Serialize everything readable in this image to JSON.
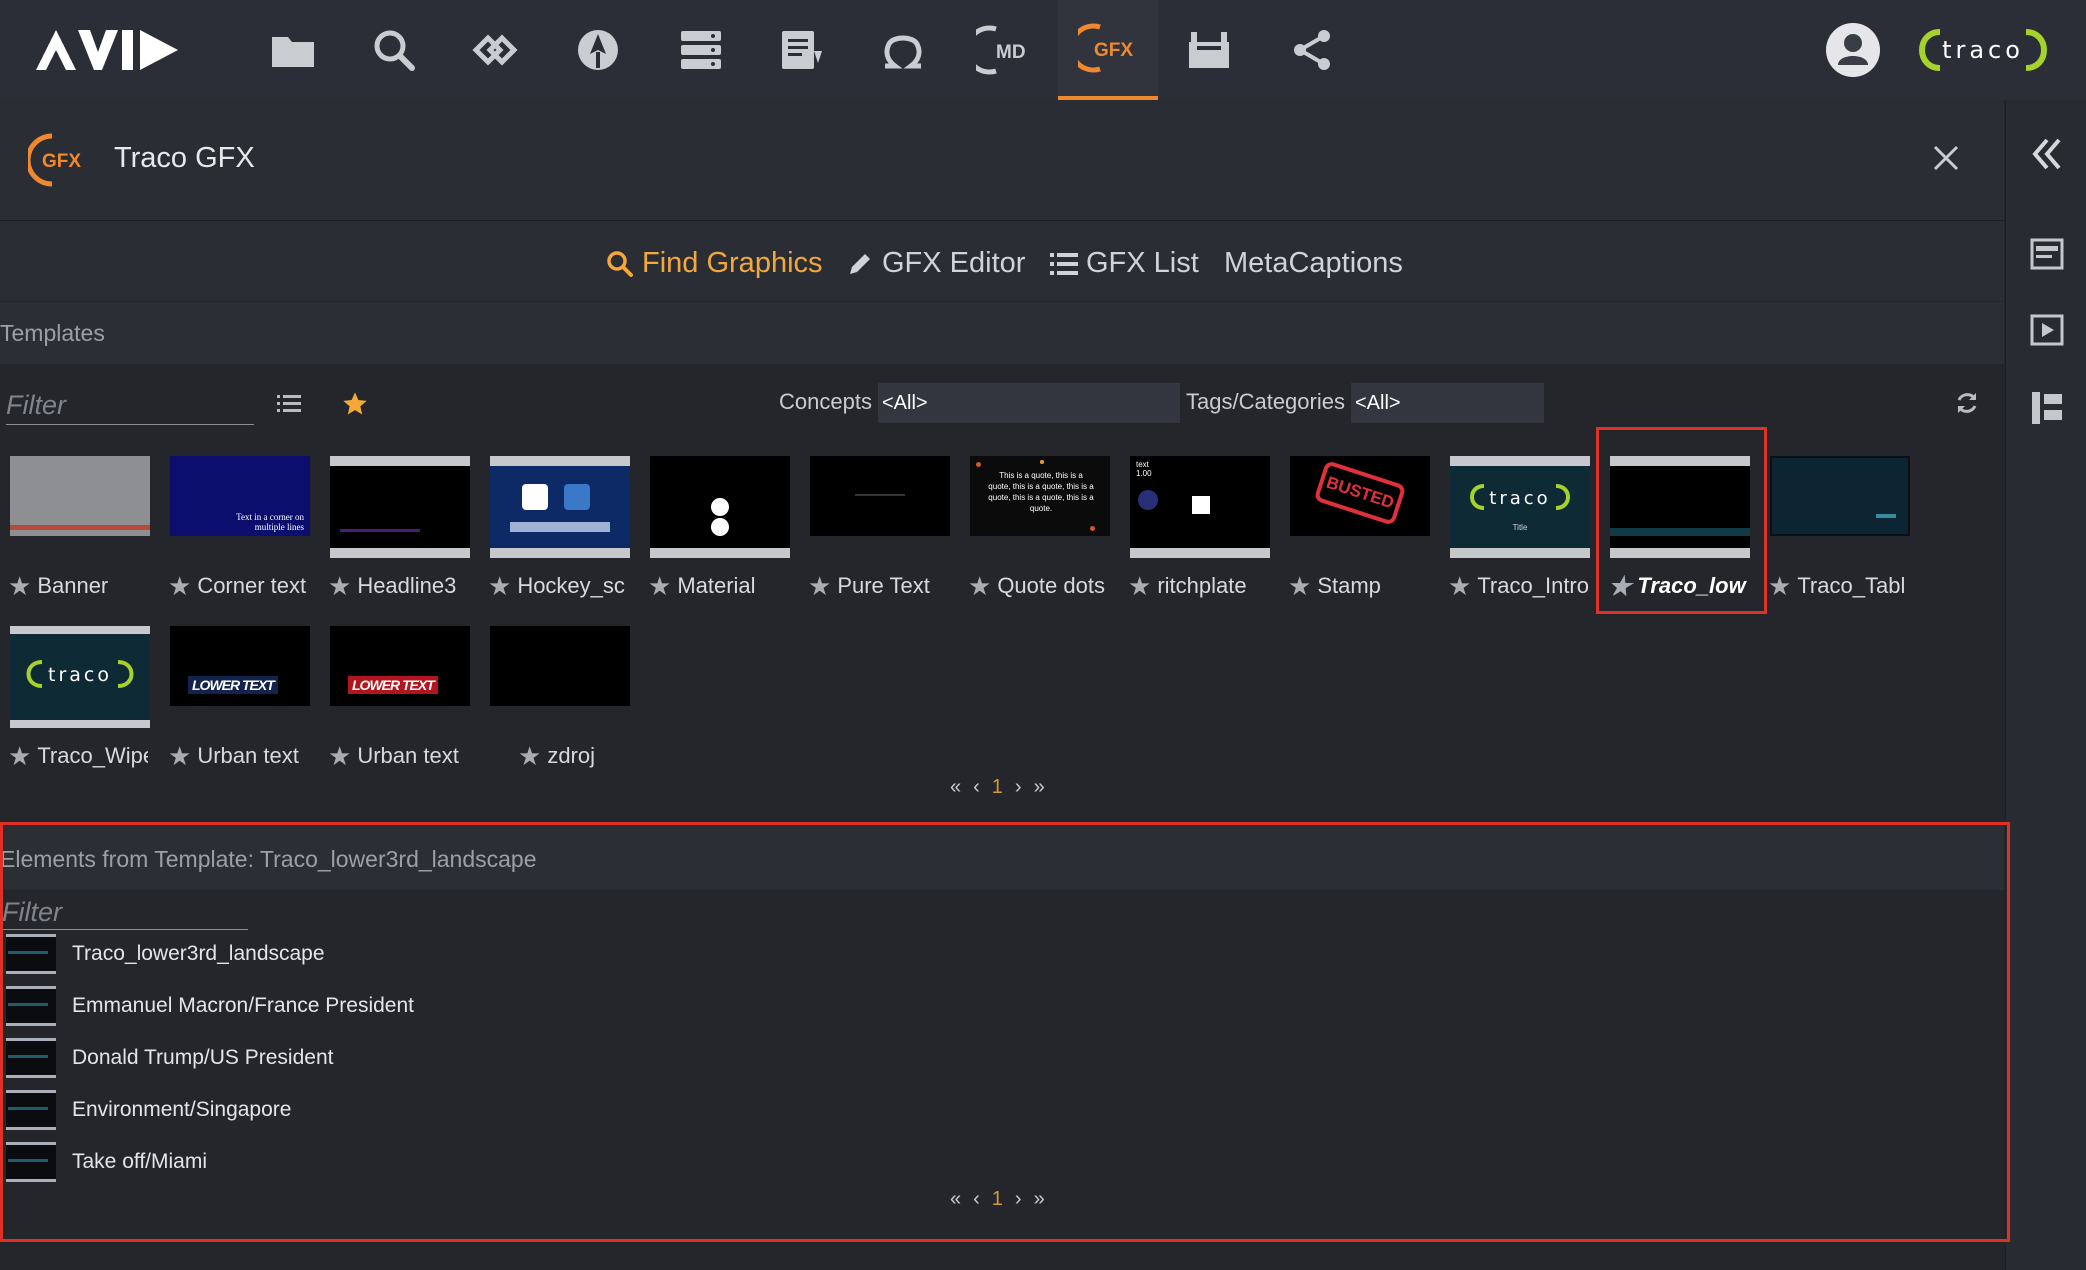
{
  "topbar": {
    "logo": "AVID",
    "nav": [
      {
        "name": "folder-icon"
      },
      {
        "name": "search-icon"
      },
      {
        "name": "link-icon"
      },
      {
        "name": "rocket-icon"
      },
      {
        "name": "server-icon"
      },
      {
        "name": "document-icon"
      },
      {
        "name": "omega-icon"
      },
      {
        "name": "md-icon",
        "label": "MD"
      },
      {
        "name": "gfx-icon",
        "label": "GFX",
        "active": true
      },
      {
        "name": "clapper-icon"
      },
      {
        "name": "share-icon"
      }
    ],
    "brand": "traco",
    "accent": "#f0882e"
  },
  "panel": {
    "icon_label": "GFX",
    "title": "Traco GFX",
    "tabs": {
      "find": "Find Graphics",
      "editor": "GFX Editor",
      "list": "GFX List",
      "meta": "MetaCaptions"
    },
    "templates": {
      "section_title": "Templates",
      "filter_placeholder": "Filter",
      "concepts_label": "Concepts",
      "concepts_value": "<All>",
      "tags_label": "Tags/Categories",
      "tags_value": "<All>",
      "items": [
        {
          "label": "Banner"
        },
        {
          "label": "Corner text",
          "thumb_text": "Text in a corner on multiple lines"
        },
        {
          "label": "Headline3"
        },
        {
          "label": "Hockey_sc"
        },
        {
          "label": "Material"
        },
        {
          "label": "Pure Text"
        },
        {
          "label": "Quote dots",
          "thumb_text": "This is a quote, this is a quote, this is a quote, this is a quote, this is a quote, this is a quote."
        },
        {
          "label": "ritchplate",
          "thumb_text": "text 1.00"
        },
        {
          "label": "Stamp",
          "thumb_text": "BUSTED"
        },
        {
          "label": "Traco_Intro",
          "thumb_text": "traco",
          "thumb_sub": "Title"
        },
        {
          "label": "Traco_low",
          "selected": true
        },
        {
          "label": "Traco_Tabl"
        },
        {
          "label": "Traco_Wipe",
          "thumb_text": "traco"
        },
        {
          "label": "Urban text",
          "thumb_text": "LOWER TEXT"
        },
        {
          "label": "Urban text",
          "thumb_text": "LOWER TEXT"
        },
        {
          "label": "zdroj"
        }
      ],
      "pager": {
        "first": "«",
        "prev": "‹",
        "page": "1",
        "next": "›",
        "last": "»"
      }
    },
    "elements": {
      "section_title": "Elements from Template: Traco_lower3rd_landscape",
      "filter_placeholder": "Filter",
      "rows": [
        "Traco_lower3rd_landscape",
        "Emmanuel Macron/France President",
        "Donald Trump/US President",
        "Environment/Singapore",
        "Take off/Miami"
      ],
      "pager": {
        "first": "«",
        "prev": "‹",
        "page": "1",
        "next": "›",
        "last": "»"
      }
    }
  },
  "right_strip": [
    {
      "name": "collapse-icon"
    },
    {
      "name": "layout-icon"
    },
    {
      "name": "play-icon"
    },
    {
      "name": "panels-icon"
    }
  ]
}
